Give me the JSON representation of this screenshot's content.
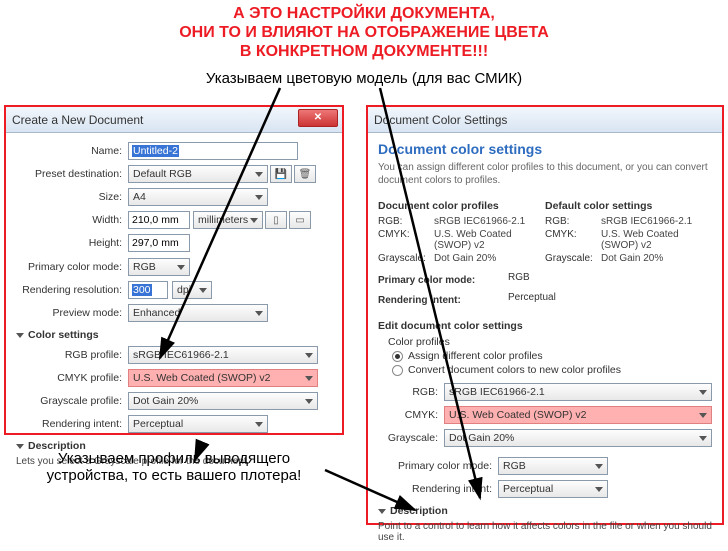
{
  "annotations": {
    "red1": "А ЭТО НАСТРОЙКИ ДОКУМЕНТА,",
    "red2": "ОНИ ТО И ВЛИЯЮТ НА ОТОБРАЖЕНИЕ ЦВЕТА",
    "red3": "В КОНКРЕТНОМ ДОКУМЕНТЕ!!!",
    "black1": "Указываем цветовую модель (для вас СМИК)",
    "black2a": "Указываем профиль выводящего",
    "black2b": "устройства, то есть вашего плотера!"
  },
  "left": {
    "title": "Create a New Document",
    "name_lbl": "Name:",
    "name_val": "Untitled-2",
    "preset_lbl": "Preset destination:",
    "preset_val": "Default RGB",
    "size_lbl": "Size:",
    "size_val": "A4",
    "width_lbl": "Width:",
    "width_val": "210,0 mm",
    "width_units": "millimeters",
    "height_lbl": "Height:",
    "height_val": "297,0 mm",
    "color_mode_lbl": "Primary color mode:",
    "color_mode_val": "RGB",
    "res_lbl": "Rendering resolution:",
    "res_val": "300",
    "res_unit": "dpi",
    "preview_lbl": "Preview mode:",
    "preview_val": "Enhanced",
    "cs_hdr": "Color settings",
    "rgb_prof_lbl": "RGB profile:",
    "rgb_prof_val": "sRGB IEC61966-2.1",
    "cmyk_prof_lbl": "CMYK profile:",
    "cmyk_prof_val": "U.S. Web Coated (SWOP) v2",
    "gray_prof_lbl": "Grayscale profile:",
    "gray_prof_val": "Dot Gain 20%",
    "intent_lbl": "Rendering intent:",
    "intent_val": "Perceptual",
    "desc_hdr": "Description",
    "desc_txt": "Lets you select a Grayscale profile for the document."
  },
  "right": {
    "title": "Document Color Settings",
    "header": "Document color settings",
    "sub": "You can assign different color profiles to this document, or you can convert document colors to profiles.",
    "profiles_hdr": "Document color profiles",
    "defaults_hdr": "Default color settings",
    "rgb_k": "RGB:",
    "rgb_v": "sRGB IEC61966-2.1",
    "cmyk_k": "CMYK:",
    "cmyk_v": "U.S. Web Coated (SWOP) v2",
    "gray_k": "Grayscale:",
    "gray_v": "Dot Gain 20%",
    "pcm_lbl": "Primary color mode:",
    "pcm_val": "RGB",
    "ri_lbl": "Rendering intent:",
    "ri_val": "Perceptual",
    "edit_hdr": "Edit document color settings",
    "cp_lbl": "Color profiles",
    "opt_assign": "Assign different color profiles",
    "opt_convert": "Convert document colors to new color profiles",
    "e_rgb_lbl": "RGB:",
    "e_rgb_val": "sRGB IEC61966-2.1",
    "e_cmyk_lbl": "CMYK:",
    "e_cmyk_val": "U.S. Web Coated (SWOP) v2",
    "e_gray_lbl": "Grayscale:",
    "e_gray_val": "Dot Gain 20%",
    "e_pcm_lbl": "Primary color mode:",
    "e_pcm_val": "RGB",
    "e_ri_lbl": "Rendering intent:",
    "e_ri_val": "Perceptual",
    "desc_hdr": "Description",
    "desc_txt": "Point to a control to learn how it affects colors in the file or when you should use it."
  }
}
